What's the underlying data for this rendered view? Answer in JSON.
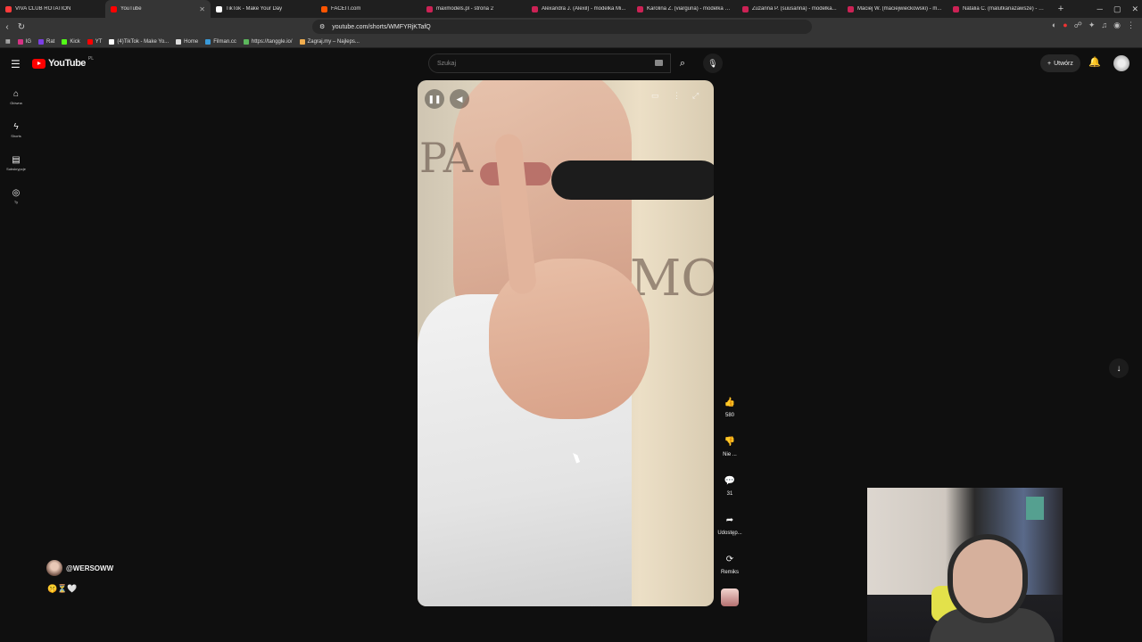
{
  "browser": {
    "tabs": [
      {
        "label": "VIVA CLUB ROTATION",
        "color": "#ff3b3b"
      },
      {
        "label": "YouTube",
        "color": "#ff0000",
        "active": true
      },
      {
        "label": "TikTok - Make Your Day",
        "color": "#ffffff"
      },
      {
        "label": "FACEIT.com",
        "color": "#ff5500"
      },
      {
        "label": "maxmodels.pl - strona 2",
        "color": "#cc2255"
      },
      {
        "label": "Alexandra J. (Alexil) - modelka Mi...",
        "color": "#cc2255"
      },
      {
        "label": "Karolina Z. (viarguna) - modelka M...",
        "color": "#cc2255"
      },
      {
        "label": "Zuzanna P. (suusanna) - modelka...",
        "color": "#cc2255"
      },
      {
        "label": "Maciej W. (maciejwieckowski) - m...",
        "color": "#cc2255"
      },
      {
        "label": "Natalia C. (malutkanazawsze) - m...",
        "color": "#cc2255"
      }
    ],
    "url": "youtube.com/shorts/WMFYRjKTafQ",
    "bookmarks": [
      {
        "label": "IG",
        "color": "#d63384"
      },
      {
        "label": "Rat",
        "color": "#7b3fe4"
      },
      {
        "label": "Kick",
        "color": "#53fc18"
      },
      {
        "label": "YT",
        "color": "#ff0000"
      },
      {
        "label": "(4)TikTok - Make Yo...",
        "color": "#ffffff"
      },
      {
        "label": "Home",
        "color": "#dddddd"
      },
      {
        "label": "Filman.cc",
        "color": "#3a9ad9"
      },
      {
        "label": "https://tanggle.io/",
        "color": "#5cb85c"
      },
      {
        "label": "Zagraj.my – Najleps...",
        "color": "#f0ad4e"
      }
    ]
  },
  "header": {
    "logo_text": "YouTube",
    "country": "PL",
    "search_placeholder": "Szukaj",
    "create_label": "Utwórz"
  },
  "sidebar": {
    "items": [
      {
        "label": "Główna",
        "icon": "home-icon"
      },
      {
        "label": "Shorts",
        "icon": "shorts-icon"
      },
      {
        "label": "Subskrypcje",
        "icon": "subscriptions-icon"
      },
      {
        "label": "Ty",
        "icon": "you-icon"
      }
    ]
  },
  "video": {
    "overlay_text_1": "PA",
    "overlay_text_2": "MOT"
  },
  "actions": {
    "likes": "580",
    "dislike_label": "Nie ...",
    "comments": "31",
    "share_label": "Udostęp...",
    "remix_label": "Remiks"
  },
  "channel": {
    "name": "@WERSOWW",
    "emojis": "🤫⏳🤍"
  }
}
